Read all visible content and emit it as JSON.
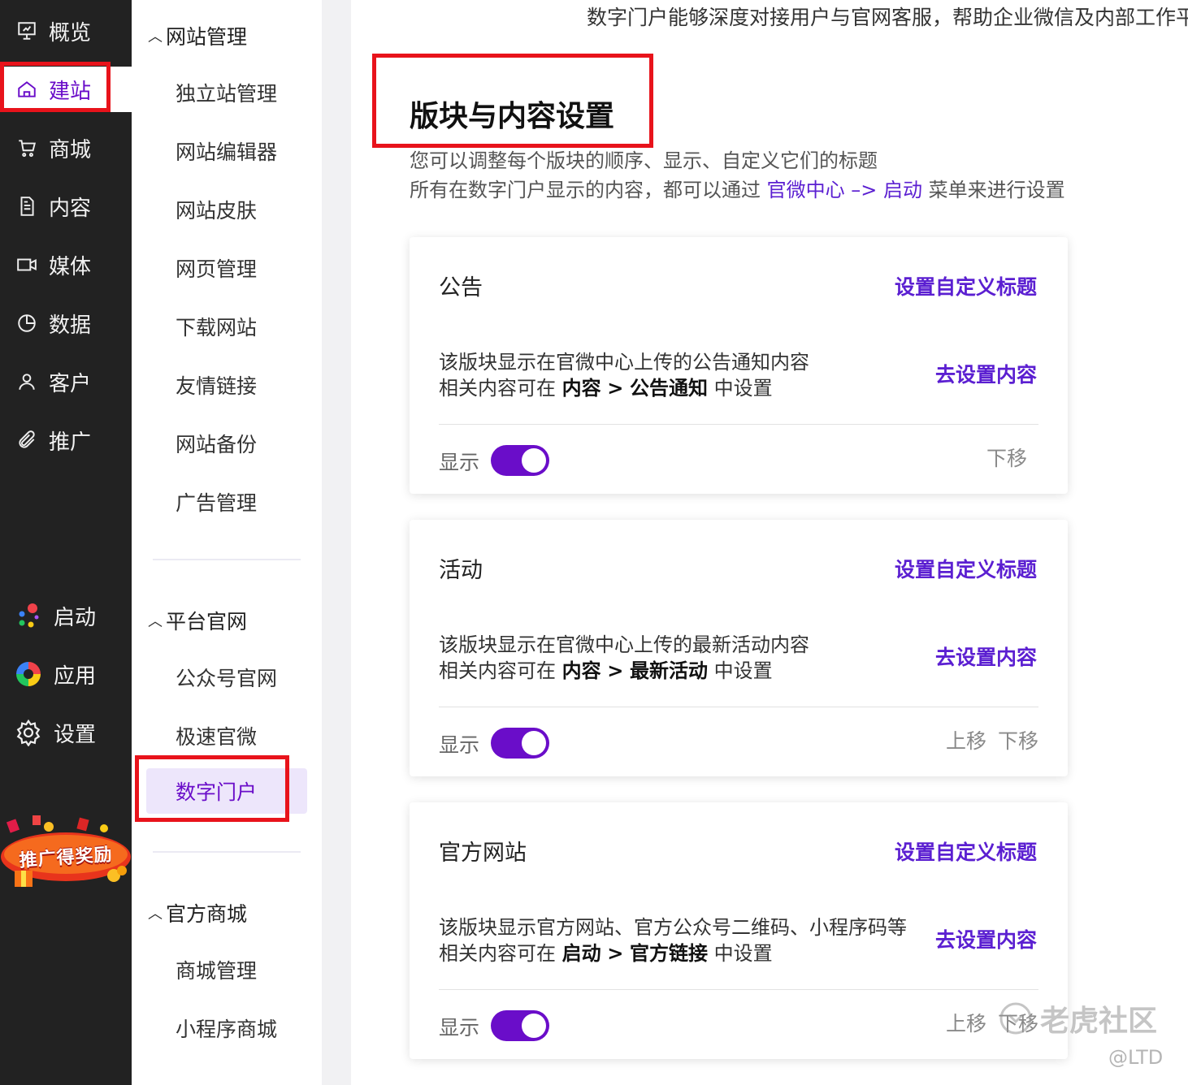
{
  "nav": {
    "items": [
      {
        "label": "概览",
        "icon": "presentation-icon"
      },
      {
        "label": "建站",
        "icon": "home-icon"
      },
      {
        "label": "商城",
        "icon": "cart-icon"
      },
      {
        "label": "内容",
        "icon": "document-icon"
      },
      {
        "label": "媒体",
        "icon": "video-icon"
      },
      {
        "label": "数据",
        "icon": "pie-chart-icon"
      },
      {
        "label": "客户",
        "icon": "user-icon"
      },
      {
        "label": "推广",
        "icon": "paperclip-icon"
      }
    ],
    "bottom_items": [
      {
        "label": "启动",
        "icon": "launch-dots-icon"
      },
      {
        "label": "应用",
        "icon": "apps-ring-icon"
      },
      {
        "label": "设置",
        "icon": "gear-icon"
      }
    ],
    "promo": "推广得奖励"
  },
  "menu": {
    "groups": [
      {
        "label": "网站管理",
        "items": [
          "独立站管理",
          "网站编辑器",
          "网站皮肤",
          "网页管理",
          "下载网站",
          "友情链接",
          "网站备份",
          "广告管理"
        ]
      },
      {
        "label": "平台官网",
        "items": [
          "公众号官网",
          "极速官微",
          "数字门户"
        ]
      },
      {
        "label": "官方商城",
        "items": [
          "商城管理",
          "小程序商城"
        ]
      }
    ],
    "active_item": "数字门户"
  },
  "main": {
    "top_text": "数字门户能够深度对接用户与官网客服，帮助企业微信及内部工作平",
    "title": "版块与内容设置",
    "desc1": "您可以调整每个版块的顺序、显示、自定义它们的标题",
    "desc2_prefix": "所有在数字门户显示的内容，都可以通过",
    "desc2_link": "官微中心 –> 启动",
    "desc2_suffix": "菜单来进行设置",
    "cards": [
      {
        "title": "公告",
        "custom_title_link": "设置自定义标题",
        "desc_line1": "该版块显示在官微中心上传的公告通知内容",
        "desc_prefix": "相关内容可在",
        "desc_bold1": "内容",
        "desc_sep": ">",
        "desc_bold2": "公告通知",
        "desc_suffix": "中设置",
        "content_link": "去设置内容",
        "show_label": "显示",
        "toggle_on": true,
        "move_up": "",
        "move_down": "下移"
      },
      {
        "title": "活动",
        "custom_title_link": "设置自定义标题",
        "desc_line1": "该版块显示在官微中心上传的最新活动内容",
        "desc_prefix": "相关内容可在",
        "desc_bold1": "内容",
        "desc_sep": ">",
        "desc_bold2": "最新活动",
        "desc_suffix": "中设置",
        "content_link": "去设置内容",
        "show_label": "显示",
        "toggle_on": true,
        "move_up": "上移",
        "move_down": "下移"
      },
      {
        "title": "官方网站",
        "custom_title_link": "设置自定义标题",
        "desc_line1": "该版块显示官方网站、官方公众号二维码、小程序码等",
        "desc_prefix": "相关内容可在",
        "desc_bold1": "启动",
        "desc_sep": ">",
        "desc_bold2": "官方链接",
        "desc_suffix": "中设置",
        "content_link": "去设置内容",
        "show_label": "显示",
        "toggle_on": true,
        "move_up": "上移",
        "move_down": "下移"
      }
    ]
  },
  "watermark": {
    "text": "老虎社区",
    "handle": "@LTD"
  },
  "colors": {
    "accent": "#6a0dc9",
    "link": "#5b1fd1",
    "nav_bg": "#222222",
    "highlight_box": "#e8131b"
  }
}
